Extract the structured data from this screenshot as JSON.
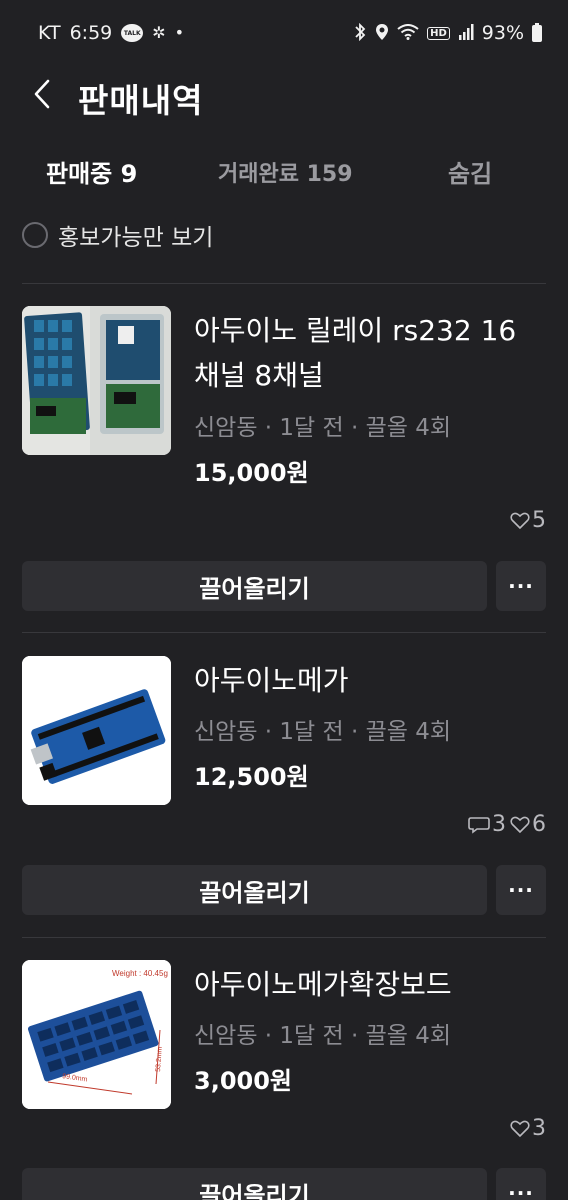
{
  "status_bar": {
    "carrier": "KT",
    "time": "6:59",
    "talk_badge": "TALK",
    "battery": "93%"
  },
  "header": {
    "title": "판매내역",
    "back_icon": "chevron-left-icon"
  },
  "tabs": [
    {
      "label": "판매중 9",
      "active": true
    },
    {
      "label": "거래완료 159",
      "active": false
    },
    {
      "label": "숨김",
      "active": false
    }
  ],
  "filter": {
    "label": "홍보가능만 보기",
    "checked": false
  },
  "items": [
    {
      "title": "아두이노 릴레이 rs232 16채널 8채널",
      "meta": "신암동 · 1달 전 · 끌올 4회",
      "price": "15,000원",
      "chats": "",
      "likes": "5",
      "bump_label": "끌어올리기",
      "more_label": "···"
    },
    {
      "title": "아두이노메가",
      "meta": "신암동 · 1달 전 · 끌올 4회",
      "price": "12,500원",
      "chats": "3",
      "likes": "6",
      "bump_label": "끌어올리기",
      "more_label": "···"
    },
    {
      "title": "아두이노메가확장보드",
      "meta": "신암동 · 1달 전 · 끌올 4회",
      "price": "3,000원",
      "chats": "",
      "likes": "3",
      "weight_label": "Weight : 40.45g",
      "dim_label_1": "99.0mm",
      "dim_label_2": "53.2mm",
      "bump_label": "끌어올리기",
      "more_label": "···"
    }
  ],
  "colors": {
    "background": "#212124",
    "button_bg": "#2f2f33",
    "muted_text": "#8c8c92",
    "divider": "#38383c"
  }
}
